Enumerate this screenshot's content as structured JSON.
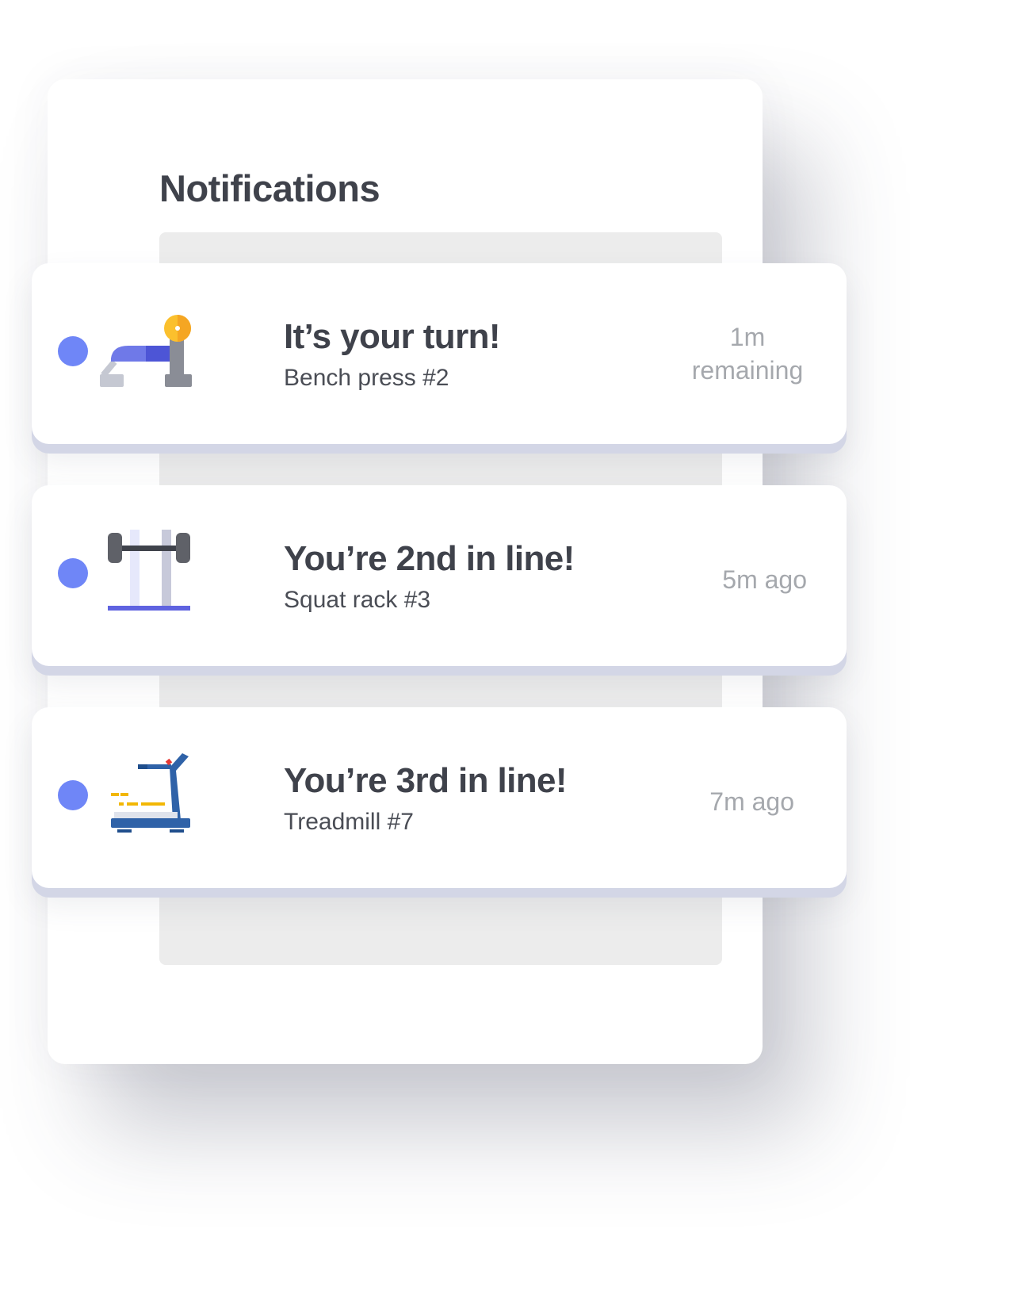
{
  "panel": {
    "title": "Notifications"
  },
  "notifications": [
    {
      "title": "It’s your turn!",
      "subtitle": "Bench press #2",
      "time": "1m remaining",
      "icon": "bench-press-icon"
    },
    {
      "title": "You’re 2nd in line!",
      "subtitle": "Squat rack #3",
      "time": "5m ago",
      "icon": "squat-rack-icon"
    },
    {
      "title": "You’re 3rd in line!",
      "subtitle": "Treadmill #7",
      "time": "7m ago",
      "icon": "treadmill-icon"
    }
  ],
  "colors": {
    "unread_dot": "#6f86f7",
    "title_text": "#3f424b",
    "time_text": "#a5a8ad",
    "card_edge": "#d3d6e6"
  }
}
